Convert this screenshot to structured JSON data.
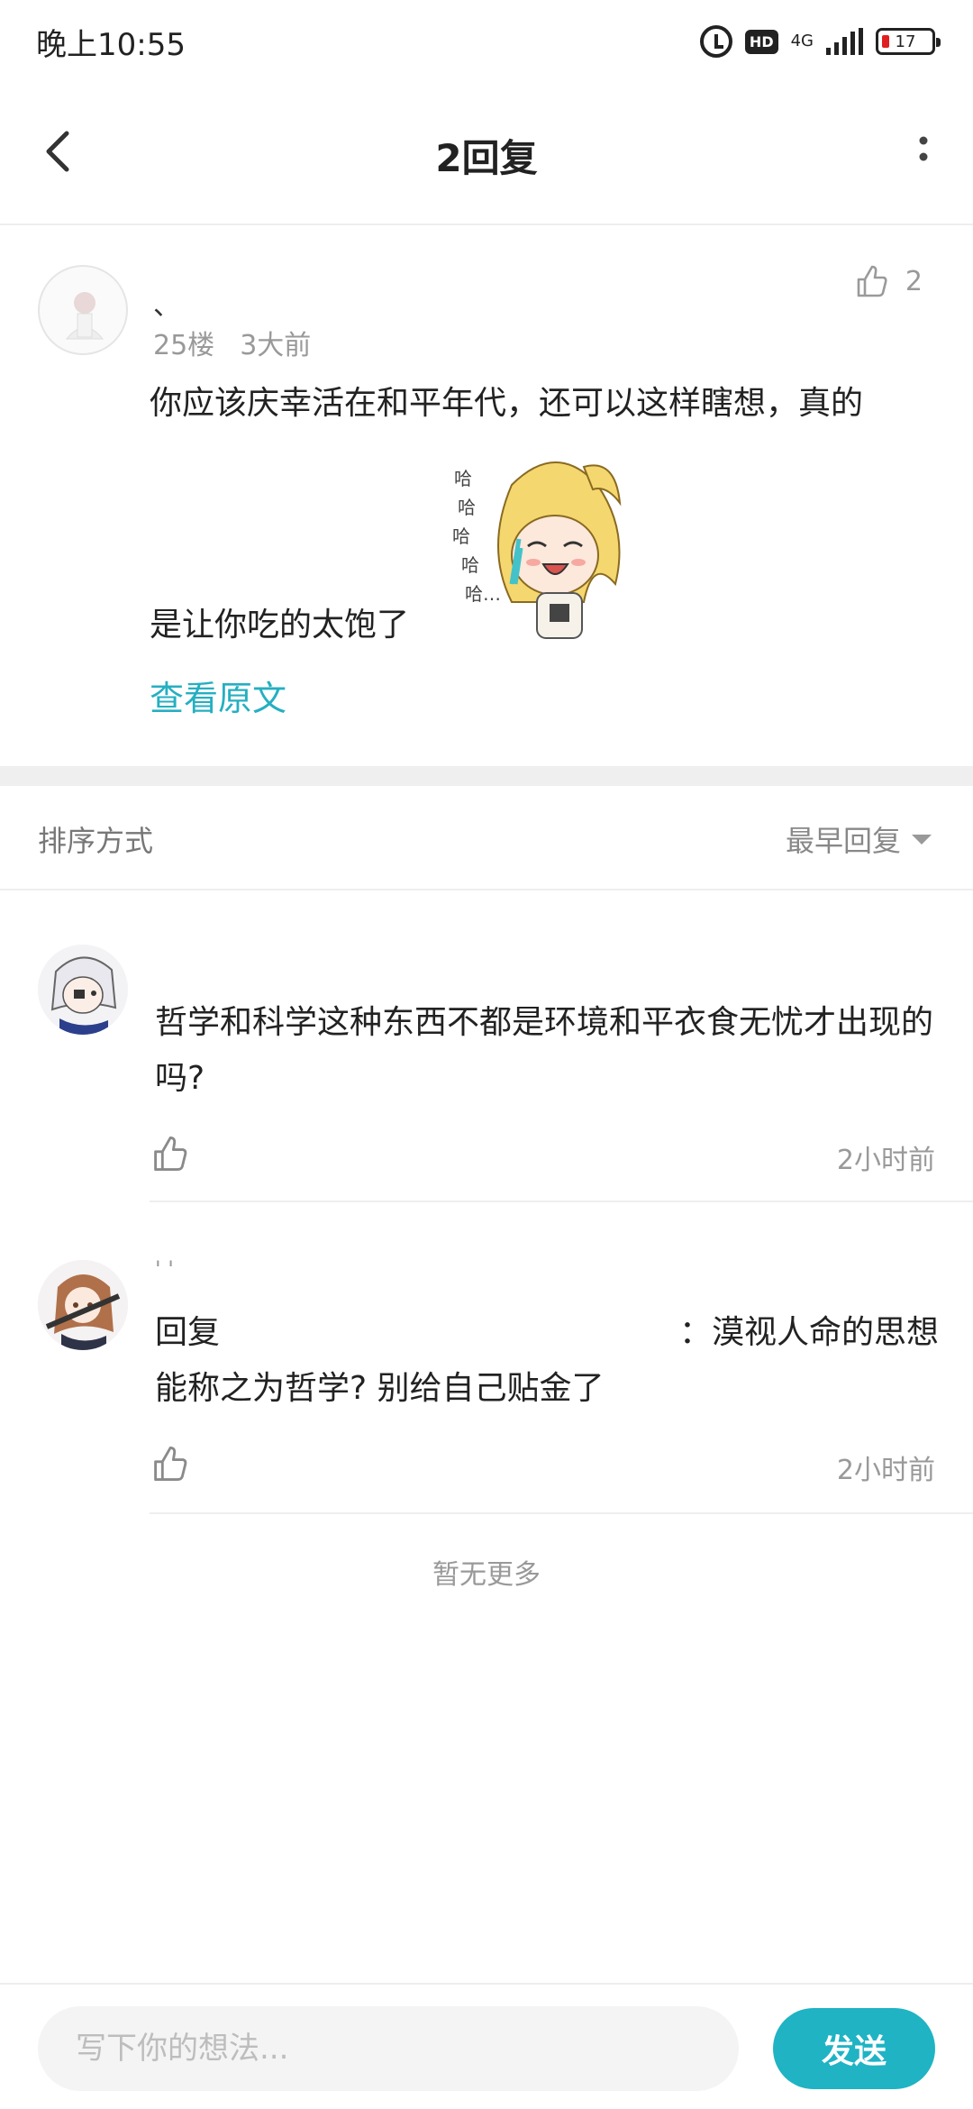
{
  "status_bar": {
    "time": "晚上10:55",
    "hd_label": "HD",
    "network": "4G",
    "battery": "17"
  },
  "nav": {
    "title": "2回复",
    "back_icon": "chevron-left-icon",
    "more_icon": "more-vertical-icon"
  },
  "main_comment": {
    "username": "、",
    "floor": "25楼",
    "time_ago": "3大前",
    "like_count": "2",
    "text_line1": "你应该庆幸活在和平年代，还可以这样瞎想，真的",
    "text_line2": "是让你吃的太饱了",
    "sticker": "laughing-anime-girl-sticker",
    "view_original": "查看原文"
  },
  "sort": {
    "label": "排序方式",
    "selected": "最早回复"
  },
  "replies": [
    {
      "username": "",
      "text": "哲学和科学这种东西不都是环境和平衣食无忧才出现的吗?",
      "time": "2小时前"
    },
    {
      "username": "' '",
      "text_prefix": "回复",
      "text_suffix": "：漠视人命的思想",
      "text_line2": "能称之为哲学? 别给自己贴金了",
      "time": "2小时前"
    }
  ],
  "no_more": "暂无更多",
  "composer": {
    "placeholder": "写下你的想法...",
    "send_label": "发送"
  },
  "colors": {
    "accent": "#1fb3c4",
    "link": "#25afc1",
    "muted_text": "#999999"
  }
}
